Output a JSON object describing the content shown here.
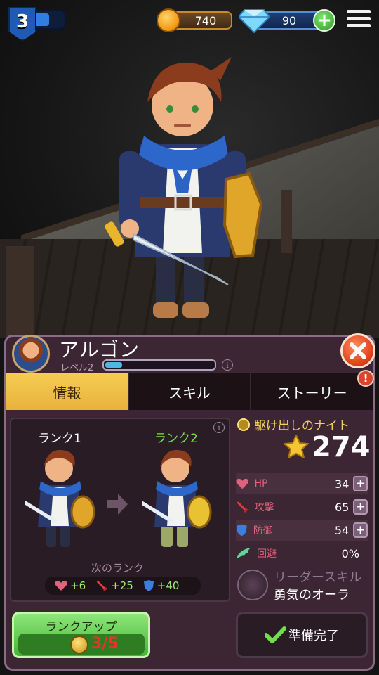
{
  "hud": {
    "player_level": "3",
    "xp_progress": 0.45,
    "gold": "740",
    "gems": "90"
  },
  "hero": {
    "name": "アルゴン",
    "level_label": "レベル2",
    "level_progress": 0.15
  },
  "tabs": [
    {
      "label": "情報",
      "active": true
    },
    {
      "label": "スキル",
      "active": false
    },
    {
      "label": "ストーリー",
      "active": false
    }
  ],
  "tab_alert": "!",
  "info_glyph": "i",
  "rank": {
    "current_label": "ランク1",
    "next_label": "ランク2",
    "next_rank_title": "次のランク",
    "bonuses": [
      {
        "stat": "hp",
        "value": "+6",
        "icon": "heart-icon"
      },
      {
        "stat": "attack",
        "value": "+25",
        "icon": "sword-icon"
      },
      {
        "stat": "defense",
        "value": "+40",
        "icon": "shield-icon"
      }
    ]
  },
  "stats": {
    "class_title": "駆け出しのナイト",
    "power": "274",
    "rows": [
      {
        "name": "HP",
        "value": "34",
        "icon": "heart-icon",
        "color": "#e0627c",
        "upgradable": true
      },
      {
        "name": "攻撃",
        "value": "65",
        "icon": "sword-icon",
        "color": "#e0627c",
        "upgradable": true
      },
      {
        "name": "防御",
        "value": "54",
        "icon": "shield-icon",
        "color": "#e0627c",
        "upgradable": true
      },
      {
        "name": "回避",
        "value": "0%",
        "icon": "wing-icon",
        "color": "#e0627c",
        "upgradable": false
      }
    ],
    "leader_label": "リーダースキル",
    "leader_skill": "勇気のオーラ"
  },
  "buttons": {
    "rankup_label": "ランクアップ",
    "rankup_count": "3/5",
    "ready_label": "準備完了"
  },
  "colors": {
    "panel": "#3c2633",
    "tab_active": "#f6cc52",
    "accent_green": "#7de04a",
    "gold_text": "#f3d15a",
    "danger": "#e0431a"
  }
}
